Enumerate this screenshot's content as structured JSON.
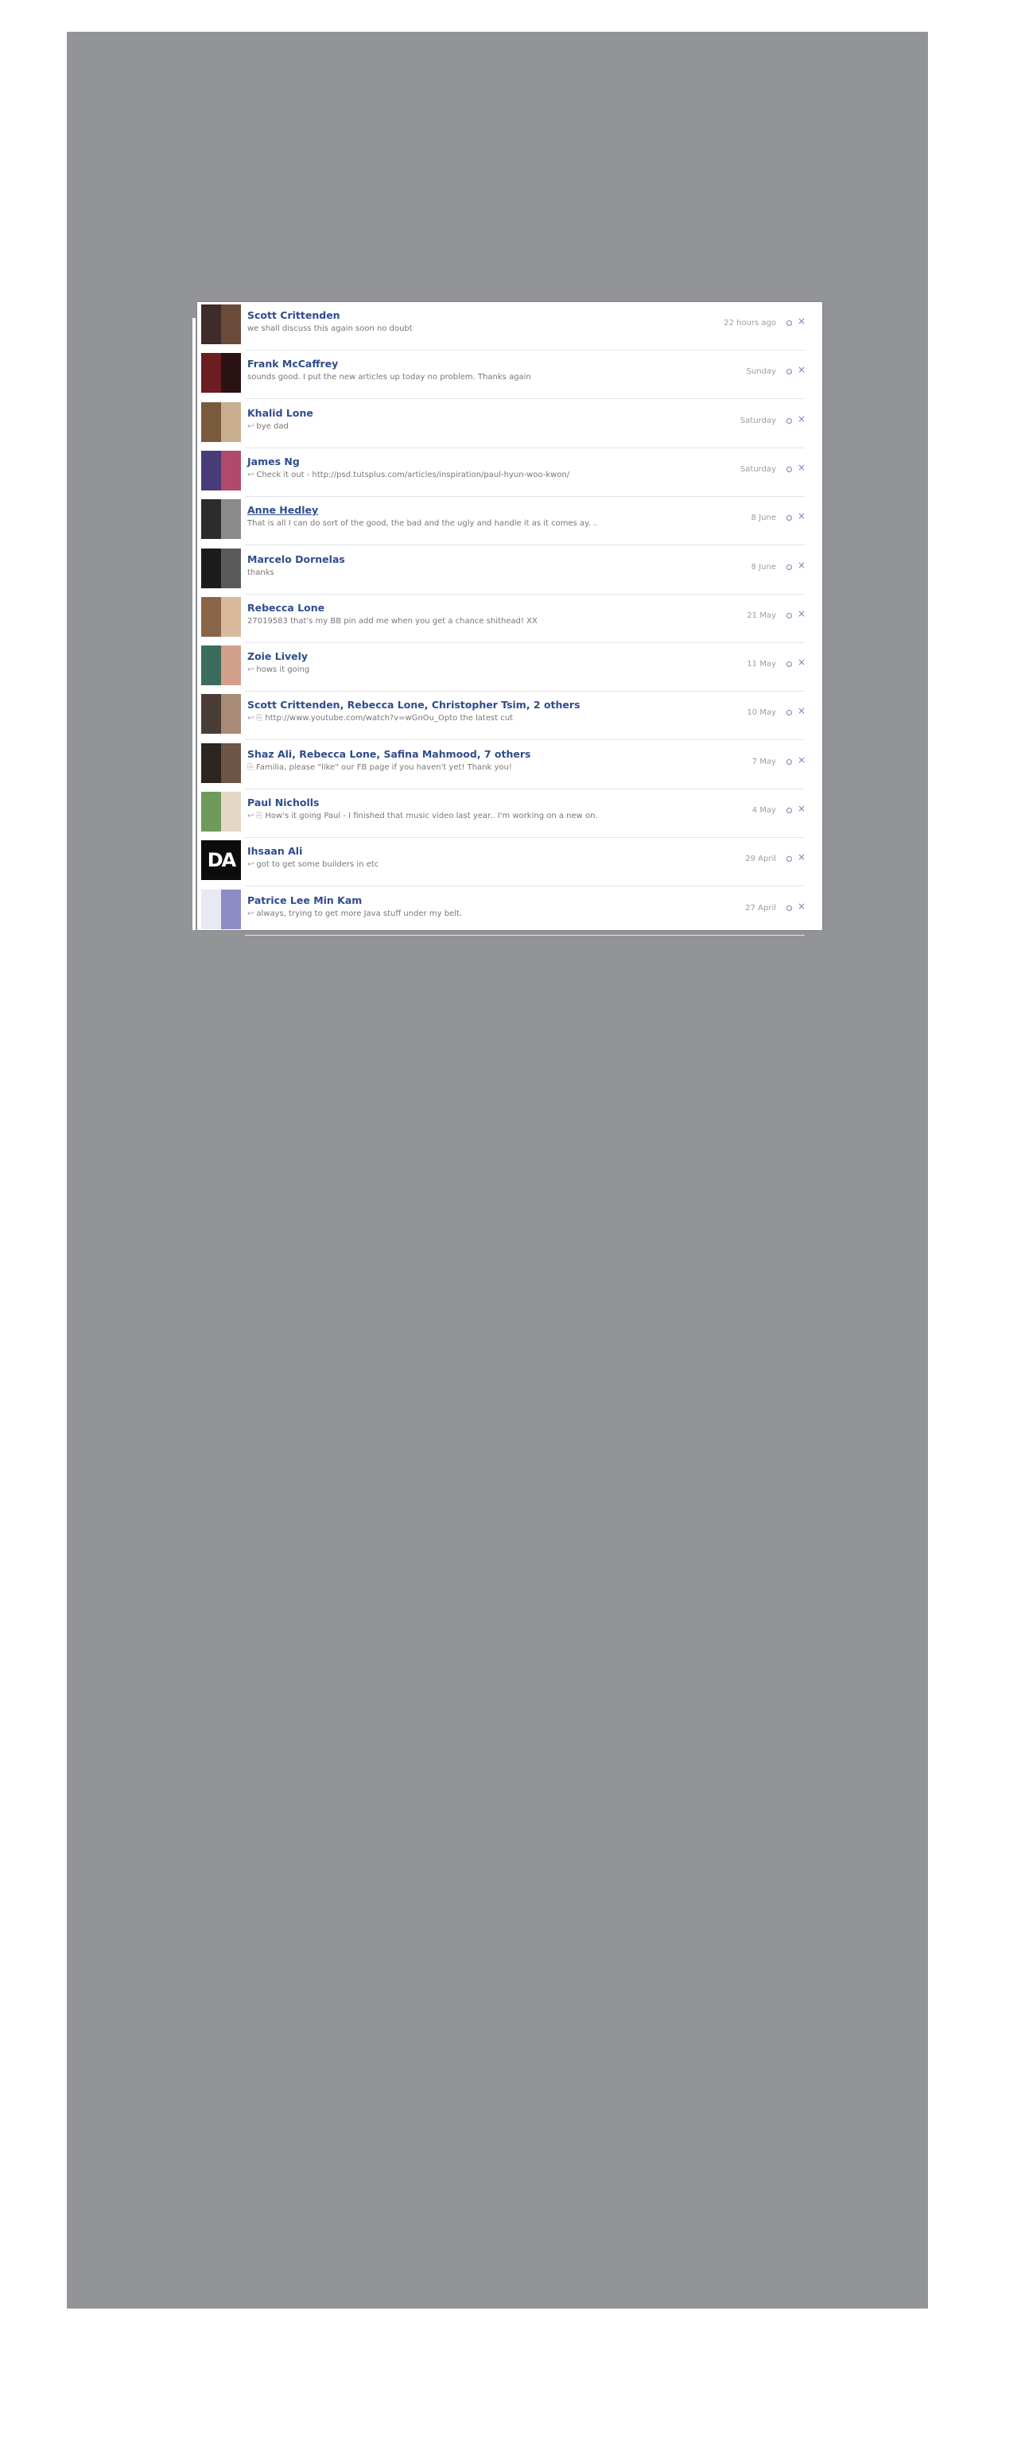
{
  "messages": [
    {
      "name": "Scott Crittenden",
      "snippet": "we shall discuss this again soon no doubt",
      "time": "22 hours ago",
      "reply_marker": "",
      "attachment_marker": "",
      "avatar_colors": [
        "#3e2b2a",
        "#6a4a3a"
      ]
    },
    {
      "name": "Frank McCaffrey",
      "snippet": "sounds good. I put the new articles up today no problem. Thanks again",
      "time": "Sunday",
      "reply_marker": "",
      "attachment_marker": "",
      "avatar_colors": [
        "#6b1d22",
        "#2a1214"
      ]
    },
    {
      "name": "Khalid Lone",
      "snippet": "bye dad",
      "time": "Saturday",
      "reply_marker": "↩",
      "attachment_marker": "",
      "avatar_colors": [
        "#7a5a3c",
        "#c8ae8e"
      ]
    },
    {
      "name": "James Ng",
      "snippet": "Check it out - http://psd.tutsplus.com/articles/inspiration/paul-hyun-woo-kwon/",
      "time": "Saturday",
      "reply_marker": "↩",
      "attachment_marker": "",
      "avatar_colors": [
        "#4a3b79",
        "#b04a6d"
      ]
    },
    {
      "name": "Anne Hedley",
      "snippet": "That is all I can do sort of the good, the bad and the ugly and handle it as it comes ay. ...",
      "time": "8 June",
      "reply_marker": "",
      "attachment_marker": "",
      "avatar_colors": [
        "#2c2c2c",
        "#8a8a8a"
      ]
    },
    {
      "name": "Marcelo Dornelas",
      "snippet": "thanks",
      "time": "8 June",
      "reply_marker": "",
      "attachment_marker": "",
      "avatar_colors": [
        "#1b1b1b",
        "#5a5a5a"
      ]
    },
    {
      "name": "Rebecca Lone",
      "snippet": "27019583 that's my BB pin add me when you get a chance shithead! XX",
      "time": "21 May",
      "reply_marker": "",
      "attachment_marker": "",
      "avatar_colors": [
        "#8a6447",
        "#d9b99b"
      ]
    },
    {
      "name": "Zoie Lively",
      "snippet": "hows it going",
      "time": "11 May",
      "reply_marker": "↩",
      "attachment_marker": "",
      "avatar_colors": [
        "#3b6c5c",
        "#d2a08a"
      ]
    },
    {
      "name": "Scott Crittenden, Rebecca Lone, Christopher Tsim, 2 others",
      "snippet": "http://www.youtube.com/watch?v=wGnOu_Opto the latest cut",
      "time": "10 May",
      "reply_marker": "↩",
      "attachment_marker": "⎘",
      "avatar_colors": [
        "#4a3d36",
        "#a88b76"
      ]
    },
    {
      "name": "Shaz Ali, Rebecca Lone, Safina Mahmood, 7 others",
      "snippet": "Familia, please \"like\" our FB page if you haven't yet! Thank you!",
      "time": "7 May",
      "reply_marker": "",
      "attachment_marker": "⎘",
      "avatar_colors": [
        "#2d2620",
        "#6e5444"
      ]
    },
    {
      "name": "Paul Nicholls",
      "snippet": "How's it going Paul - I finished that music video last year.. I'm working on a new on...",
      "time": "4 May",
      "reply_marker": "↩",
      "attachment_marker": "⎘",
      "avatar_colors": [
        "#6e9a5a",
        "#e5d7c5"
      ]
    },
    {
      "name": "Ihsaan Ali",
      "snippet": "got to get some builders in etc",
      "time": "29 April",
      "reply_marker": "↩",
      "attachment_marker": "",
      "avatar_colors": [
        "#0c0c0c",
        "#0c0c0c"
      ],
      "avatar_text": "DA"
    },
    {
      "name": "Patrice Lee Min Kam",
      "snippet": "always, trying to get more Java stuff under my belt.",
      "time": "27 April",
      "reply_marker": "↩",
      "attachment_marker": "",
      "avatar_colors": [
        "#e9e9f3",
        "#8d8cc6"
      ]
    }
  ],
  "icons": {
    "mark_read": "circle-icon",
    "remove": "close-icon",
    "reply": "reply-arrow-icon",
    "attachment": "paperclip-icon"
  }
}
